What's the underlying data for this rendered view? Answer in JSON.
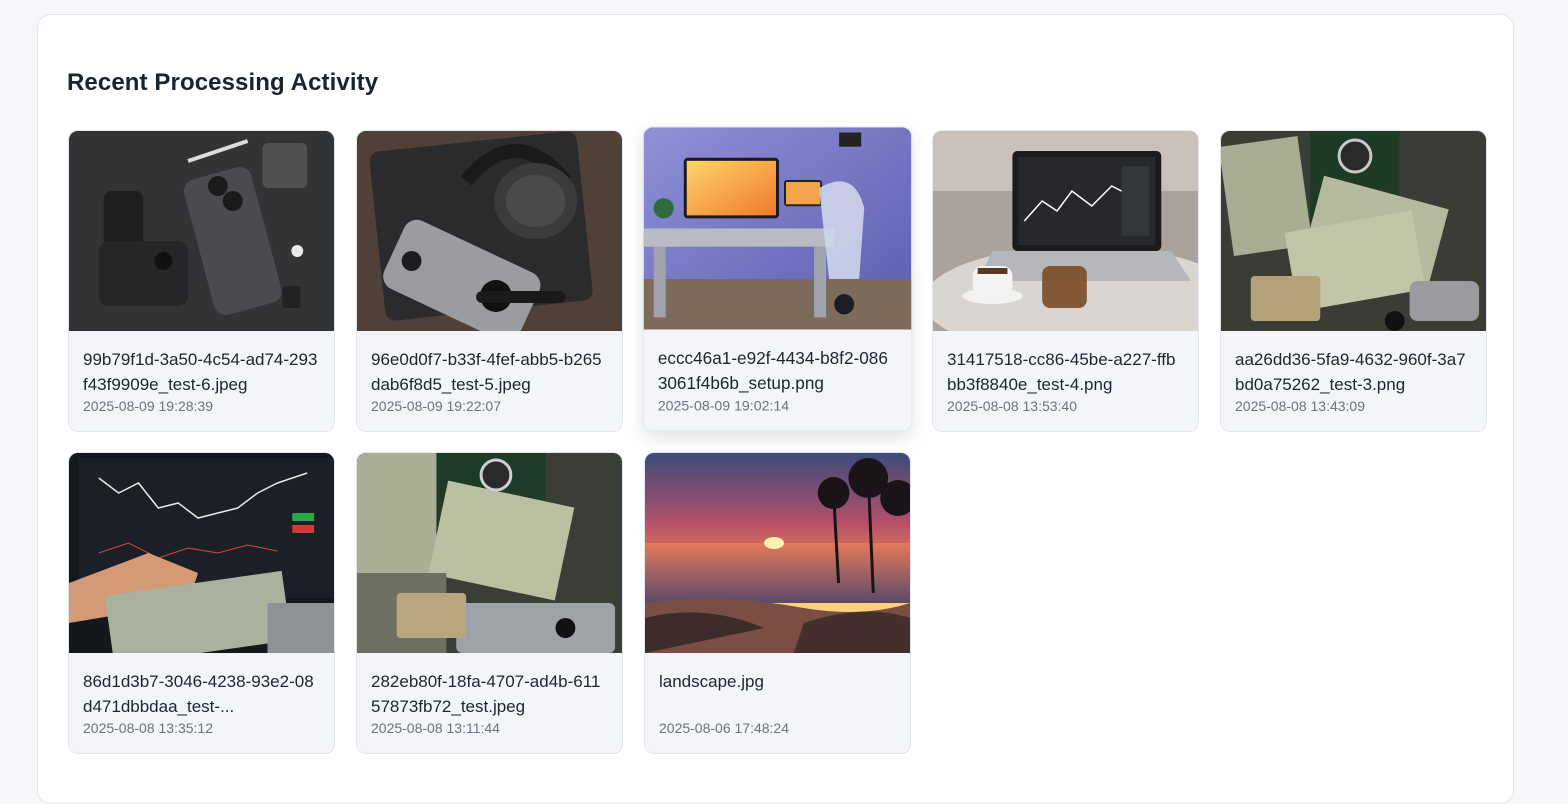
{
  "section": {
    "title": "Recent Processing Activity"
  },
  "items": [
    {
      "filename": "99b79f1d-3a50-4c54-ad74-293f43f9909e_test-6.jpeg",
      "timestamp": "2025-08-09 19:28:39",
      "thumb_icon": "camera-phone-flatlay-image"
    },
    {
      "filename": "96e0d0f7-b33f-4fef-abb5-b265dab6f8d5_test-5.jpeg",
      "timestamp": "2025-08-09 19:22:07",
      "thumb_icon": "headphones-phone-watch-image"
    },
    {
      "filename": "eccc46a1-e92f-4434-b8f2-0863061f4b6b_setup.png",
      "timestamp": "2025-08-09 19:02:14",
      "thumb_icon": "desk-setup-image"
    },
    {
      "filename": "31417518-cc86-45be-a227-ffbbb3f8840e_test-4.png",
      "timestamp": "2025-08-08 13:53:40",
      "thumb_icon": "laptop-coffee-image"
    },
    {
      "filename": "aa26dd36-5fa9-4632-960f-3a7bd0a75262_test-3.png",
      "timestamp": "2025-08-08 13:43:09",
      "thumb_icon": "cash-watch-image"
    },
    {
      "filename": "86d1d3b7-3046-4238-93e2-08d471dbbdaa_test-...",
      "timestamp": "2025-08-08 13:35:12",
      "thumb_icon": "trading-chart-cash-image"
    },
    {
      "filename": "282eb80f-18fa-4707-ad4b-61157873fb72_test.jpeg",
      "timestamp": "2025-08-08 13:11:44",
      "thumb_icon": "cash-watch-card-image"
    },
    {
      "filename": "landscape.jpg",
      "timestamp": "2025-08-06 17:48:24",
      "thumb_icon": "sunset-landscape-image"
    }
  ],
  "colors": {
    "page_bg": "#f5f7fa",
    "panel_bg": "#ffffff",
    "card_bg": "#f3f5f8",
    "text_primary": "#1f2530",
    "text_secondary": "#6b7380"
  }
}
